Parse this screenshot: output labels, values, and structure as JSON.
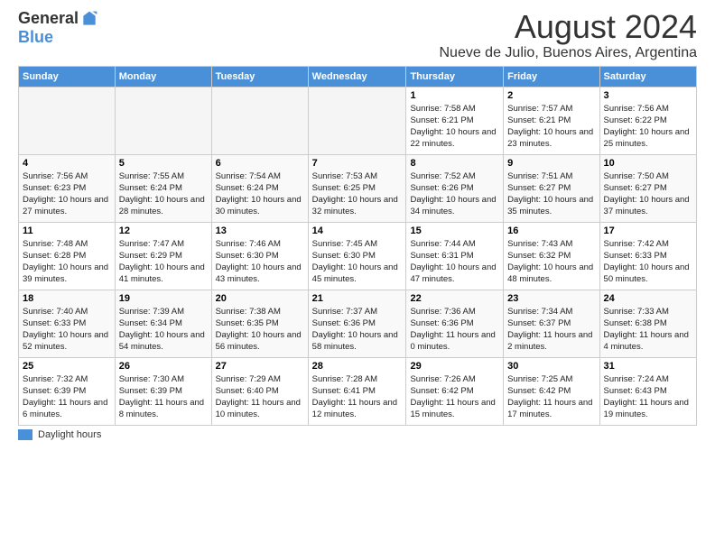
{
  "logo": {
    "general": "General",
    "blue": "Blue"
  },
  "title": "August 2024",
  "subtitle": "Nueve de Julio, Buenos Aires, Argentina",
  "days_of_week": [
    "Sunday",
    "Monday",
    "Tuesday",
    "Wednesday",
    "Thursday",
    "Friday",
    "Saturday"
  ],
  "legend_label": "Daylight hours",
  "weeks": [
    [
      {
        "day": "",
        "sunrise": "",
        "sunset": "",
        "daylight": "",
        "empty": true
      },
      {
        "day": "",
        "sunrise": "",
        "sunset": "",
        "daylight": "",
        "empty": true
      },
      {
        "day": "",
        "sunrise": "",
        "sunset": "",
        "daylight": "",
        "empty": true
      },
      {
        "day": "",
        "sunrise": "",
        "sunset": "",
        "daylight": "",
        "empty": true
      },
      {
        "day": "1",
        "sunrise": "Sunrise: 7:58 AM",
        "sunset": "Sunset: 6:21 PM",
        "daylight": "Daylight: 10 hours and 22 minutes.",
        "empty": false
      },
      {
        "day": "2",
        "sunrise": "Sunrise: 7:57 AM",
        "sunset": "Sunset: 6:21 PM",
        "daylight": "Daylight: 10 hours and 23 minutes.",
        "empty": false
      },
      {
        "day": "3",
        "sunrise": "Sunrise: 7:56 AM",
        "sunset": "Sunset: 6:22 PM",
        "daylight": "Daylight: 10 hours and 25 minutes.",
        "empty": false
      }
    ],
    [
      {
        "day": "4",
        "sunrise": "Sunrise: 7:56 AM",
        "sunset": "Sunset: 6:23 PM",
        "daylight": "Daylight: 10 hours and 27 minutes.",
        "empty": false
      },
      {
        "day": "5",
        "sunrise": "Sunrise: 7:55 AM",
        "sunset": "Sunset: 6:24 PM",
        "daylight": "Daylight: 10 hours and 28 minutes.",
        "empty": false
      },
      {
        "day": "6",
        "sunrise": "Sunrise: 7:54 AM",
        "sunset": "Sunset: 6:24 PM",
        "daylight": "Daylight: 10 hours and 30 minutes.",
        "empty": false
      },
      {
        "day": "7",
        "sunrise": "Sunrise: 7:53 AM",
        "sunset": "Sunset: 6:25 PM",
        "daylight": "Daylight: 10 hours and 32 minutes.",
        "empty": false
      },
      {
        "day": "8",
        "sunrise": "Sunrise: 7:52 AM",
        "sunset": "Sunset: 6:26 PM",
        "daylight": "Daylight: 10 hours and 34 minutes.",
        "empty": false
      },
      {
        "day": "9",
        "sunrise": "Sunrise: 7:51 AM",
        "sunset": "Sunset: 6:27 PM",
        "daylight": "Daylight: 10 hours and 35 minutes.",
        "empty": false
      },
      {
        "day": "10",
        "sunrise": "Sunrise: 7:50 AM",
        "sunset": "Sunset: 6:27 PM",
        "daylight": "Daylight: 10 hours and 37 minutes.",
        "empty": false
      }
    ],
    [
      {
        "day": "11",
        "sunrise": "Sunrise: 7:48 AM",
        "sunset": "Sunset: 6:28 PM",
        "daylight": "Daylight: 10 hours and 39 minutes.",
        "empty": false
      },
      {
        "day": "12",
        "sunrise": "Sunrise: 7:47 AM",
        "sunset": "Sunset: 6:29 PM",
        "daylight": "Daylight: 10 hours and 41 minutes.",
        "empty": false
      },
      {
        "day": "13",
        "sunrise": "Sunrise: 7:46 AM",
        "sunset": "Sunset: 6:30 PM",
        "daylight": "Daylight: 10 hours and 43 minutes.",
        "empty": false
      },
      {
        "day": "14",
        "sunrise": "Sunrise: 7:45 AM",
        "sunset": "Sunset: 6:30 PM",
        "daylight": "Daylight: 10 hours and 45 minutes.",
        "empty": false
      },
      {
        "day": "15",
        "sunrise": "Sunrise: 7:44 AM",
        "sunset": "Sunset: 6:31 PM",
        "daylight": "Daylight: 10 hours and 47 minutes.",
        "empty": false
      },
      {
        "day": "16",
        "sunrise": "Sunrise: 7:43 AM",
        "sunset": "Sunset: 6:32 PM",
        "daylight": "Daylight: 10 hours and 48 minutes.",
        "empty": false
      },
      {
        "day": "17",
        "sunrise": "Sunrise: 7:42 AM",
        "sunset": "Sunset: 6:33 PM",
        "daylight": "Daylight: 10 hours and 50 minutes.",
        "empty": false
      }
    ],
    [
      {
        "day": "18",
        "sunrise": "Sunrise: 7:40 AM",
        "sunset": "Sunset: 6:33 PM",
        "daylight": "Daylight: 10 hours and 52 minutes.",
        "empty": false
      },
      {
        "day": "19",
        "sunrise": "Sunrise: 7:39 AM",
        "sunset": "Sunset: 6:34 PM",
        "daylight": "Daylight: 10 hours and 54 minutes.",
        "empty": false
      },
      {
        "day": "20",
        "sunrise": "Sunrise: 7:38 AM",
        "sunset": "Sunset: 6:35 PM",
        "daylight": "Daylight: 10 hours and 56 minutes.",
        "empty": false
      },
      {
        "day": "21",
        "sunrise": "Sunrise: 7:37 AM",
        "sunset": "Sunset: 6:36 PM",
        "daylight": "Daylight: 10 hours and 58 minutes.",
        "empty": false
      },
      {
        "day": "22",
        "sunrise": "Sunrise: 7:36 AM",
        "sunset": "Sunset: 6:36 PM",
        "daylight": "Daylight: 11 hours and 0 minutes.",
        "empty": false
      },
      {
        "day": "23",
        "sunrise": "Sunrise: 7:34 AM",
        "sunset": "Sunset: 6:37 PM",
        "daylight": "Daylight: 11 hours and 2 minutes.",
        "empty": false
      },
      {
        "day": "24",
        "sunrise": "Sunrise: 7:33 AM",
        "sunset": "Sunset: 6:38 PM",
        "daylight": "Daylight: 11 hours and 4 minutes.",
        "empty": false
      }
    ],
    [
      {
        "day": "25",
        "sunrise": "Sunrise: 7:32 AM",
        "sunset": "Sunset: 6:39 PM",
        "daylight": "Daylight: 11 hours and 6 minutes.",
        "empty": false
      },
      {
        "day": "26",
        "sunrise": "Sunrise: 7:30 AM",
        "sunset": "Sunset: 6:39 PM",
        "daylight": "Daylight: 11 hours and 8 minutes.",
        "empty": false
      },
      {
        "day": "27",
        "sunrise": "Sunrise: 7:29 AM",
        "sunset": "Sunset: 6:40 PM",
        "daylight": "Daylight: 11 hours and 10 minutes.",
        "empty": false
      },
      {
        "day": "28",
        "sunrise": "Sunrise: 7:28 AM",
        "sunset": "Sunset: 6:41 PM",
        "daylight": "Daylight: 11 hours and 12 minutes.",
        "empty": false
      },
      {
        "day": "29",
        "sunrise": "Sunrise: 7:26 AM",
        "sunset": "Sunset: 6:42 PM",
        "daylight": "Daylight: 11 hours and 15 minutes.",
        "empty": false
      },
      {
        "day": "30",
        "sunrise": "Sunrise: 7:25 AM",
        "sunset": "Sunset: 6:42 PM",
        "daylight": "Daylight: 11 hours and 17 minutes.",
        "empty": false
      },
      {
        "day": "31",
        "sunrise": "Sunrise: 7:24 AM",
        "sunset": "Sunset: 6:43 PM",
        "daylight": "Daylight: 11 hours and 19 minutes.",
        "empty": false
      }
    ]
  ]
}
